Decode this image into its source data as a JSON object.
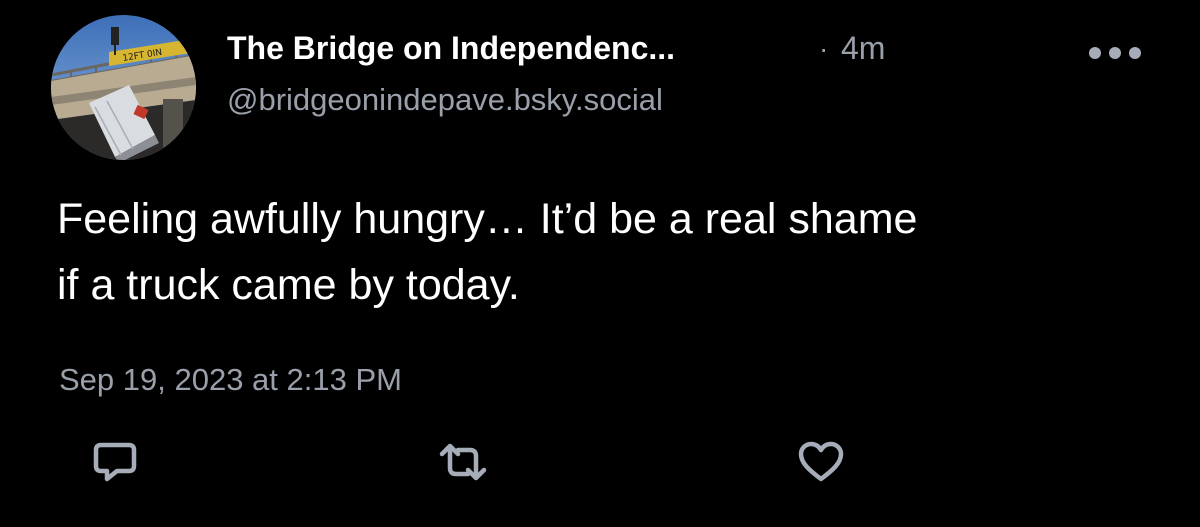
{
  "post": {
    "author": {
      "display_name": "The Bridge on Independenc...",
      "handle": "@bridgeonindepave.bsky.social",
      "avatar_sign_text": "12FT 0IN"
    },
    "separator": "·",
    "time_ago": "4m",
    "text": "Feeling awfully hungry… It’d be a real shame\nif a truck came by today.",
    "timestamp": "Sep 19, 2023 at 2:13 PM"
  },
  "actions": {
    "reply_icon": "speech-bubble-icon",
    "repost_icon": "repost-arrows-icon",
    "like_icon": "heart-icon",
    "more_icon": "ellipsis-icon"
  },
  "colors": {
    "background": "#000000",
    "primary_text": "#ffffff",
    "secondary_text": "#9aa0aa",
    "icon": "#a7adb8"
  }
}
